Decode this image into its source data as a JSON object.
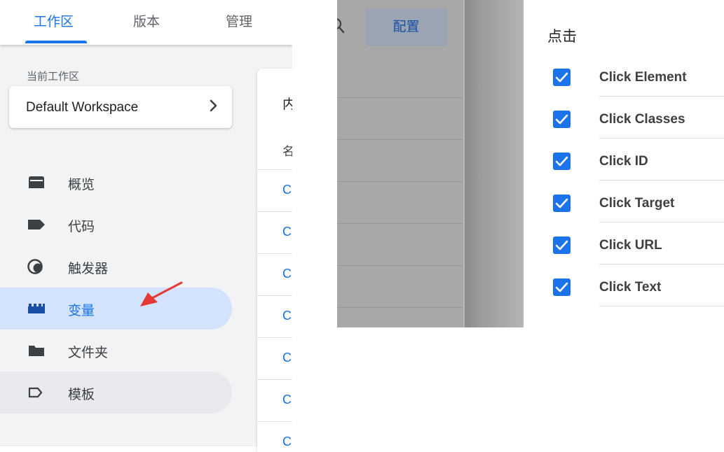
{
  "top_tabs": [
    {
      "label": "工作区",
      "active": true
    },
    {
      "label": "版本",
      "active": false
    },
    {
      "label": "管理",
      "active": false
    }
  ],
  "workspace": {
    "section_label": "当前工作区",
    "name": "Default Workspace",
    "chevron_icon": "chevron-right-icon"
  },
  "nav": [
    {
      "label": "概览",
      "icon": "overview-icon",
      "state": "normal"
    },
    {
      "label": "代码",
      "icon": "tag-icon",
      "state": "normal"
    },
    {
      "label": "触发器",
      "icon": "trigger-icon",
      "state": "normal"
    },
    {
      "label": "变量",
      "icon": "variable-icon",
      "state": "active"
    },
    {
      "label": "文件夹",
      "icon": "folder-icon",
      "state": "normal"
    },
    {
      "label": "模板",
      "icon": "template-icon",
      "state": "hover"
    }
  ],
  "content_card": {
    "heading": "内",
    "column_header": "名",
    "rows": [
      "C",
      "C",
      "C",
      "C",
      "C",
      "C",
      "C"
    ]
  },
  "annotation": {
    "icon": "red-arrow-icon",
    "color": "#e53935"
  },
  "middle": {
    "search_icon": "search-icon",
    "config_button": "配置"
  },
  "click_panel": {
    "title": "点击",
    "items": [
      {
        "label": "Click Element",
        "checked": true
      },
      {
        "label": "Click Classes",
        "checked": true
      },
      {
        "label": "Click ID",
        "checked": true
      },
      {
        "label": "Click Target",
        "checked": true
      },
      {
        "label": "Click URL",
        "checked": true
      },
      {
        "label": "Click Text",
        "checked": true
      }
    ]
  },
  "colors": {
    "accent": "#1a73e8",
    "active_nav_bg": "#d3e3fd",
    "sidebar_bg": "#f1f3f4",
    "overlay": "#a8a8a8"
  }
}
